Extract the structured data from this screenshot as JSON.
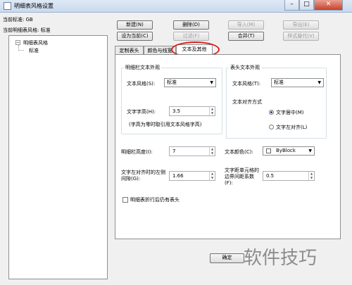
{
  "window": {
    "title": "明细表风格设置",
    "minimize": "–",
    "maximize": "□",
    "close": "✕"
  },
  "left": {
    "current_standard": "当前标准: GB",
    "current_style": "当前明细表风格: 标准",
    "tree": {
      "root": "明细表风格",
      "child": "标准"
    }
  },
  "toolbar": {
    "new": "新建(N)",
    "delete": "删除(D)",
    "import": "导入(M)",
    "export": "导出(E)",
    "set_current": "设为当前(C)",
    "filter": "过滤(F)",
    "merge": "合并(T)",
    "style_replace": "样式替代(V)"
  },
  "tabs": [
    "定制表头",
    "颜色与线宽",
    "文本及其他"
  ],
  "panel": {
    "detail_group": "明细栏文本外观",
    "text_style_label": "文本风格(S):",
    "text_style_value": "标准",
    "text_height_label": "文字字高(H):",
    "text_height_value": "3.5",
    "note": "(字高为零时取引用文本风格字高)",
    "header_group": "表头文本外观",
    "header_style_label": "文本风格(T):",
    "header_style_value": "标准",
    "align_label": "文本对齐方式",
    "align_center": "文字居中(M)",
    "align_left": "文字左对齐(L)",
    "row_height_label": "明细栏高度(I):",
    "row_height_value": "7",
    "text_color_label": "文本颜色(C):",
    "text_color_value": "ByBlock",
    "left_gap_label": "文字左对齐时的左侧间隙(G):",
    "left_gap_value": "1.66",
    "cell_gap_label": "文字距单元格的边界间距系数(F):",
    "cell_gap_value": "0.5",
    "fold_label": "明细表折行后仍有表头"
  },
  "footer": {
    "ok": "确定"
  },
  "watermark": "软件技巧",
  "colors": {
    "annotation": "#d81e1e"
  }
}
